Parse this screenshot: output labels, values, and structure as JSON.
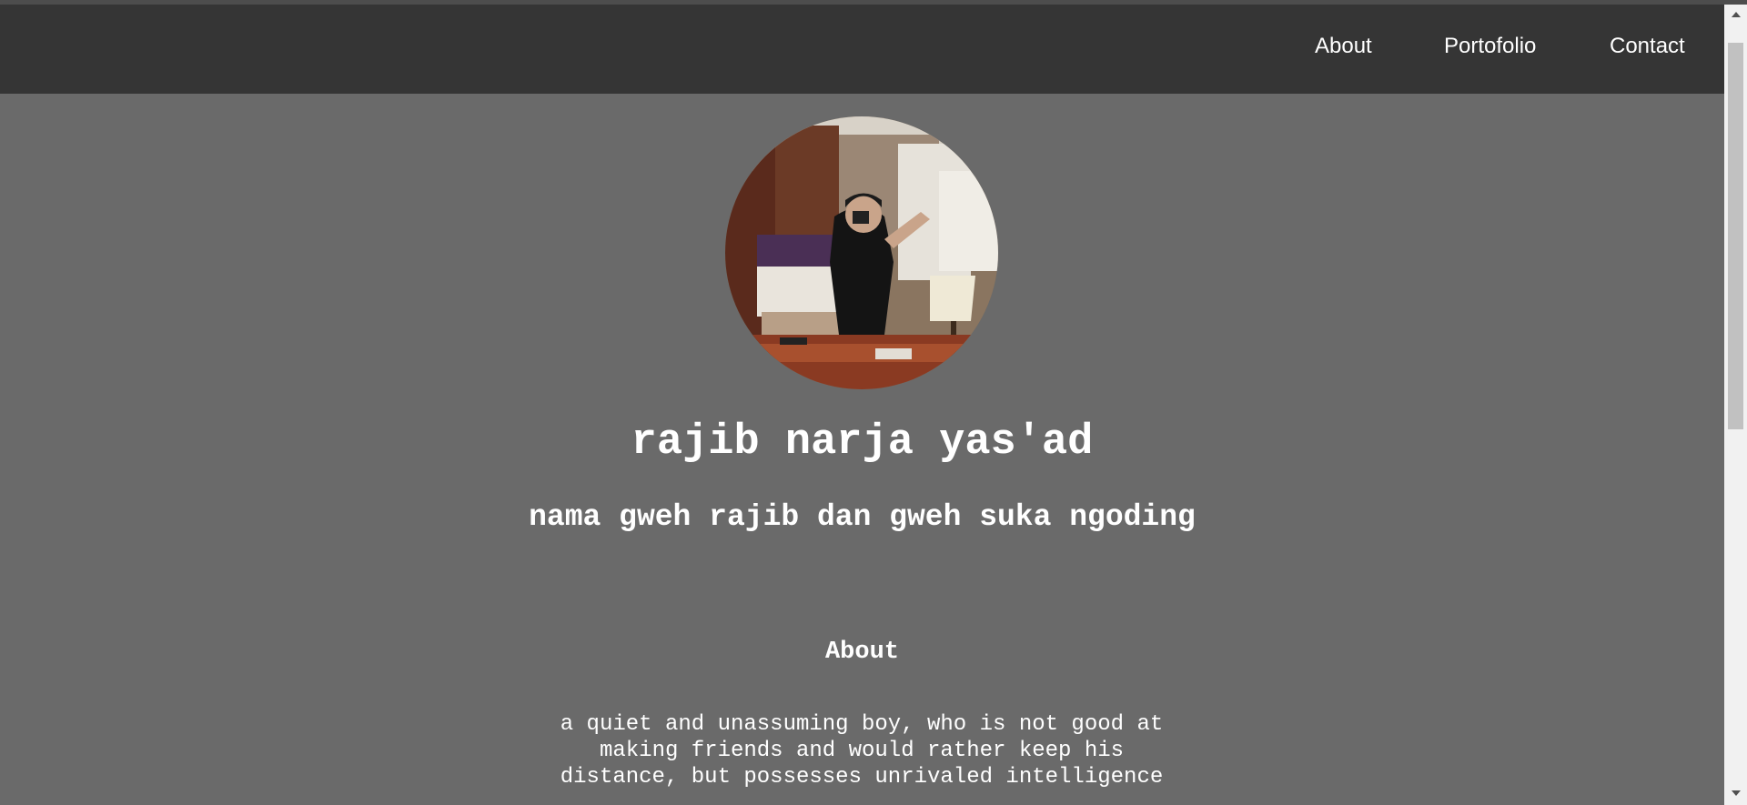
{
  "nav": {
    "about": "About",
    "portofolio": "Portofolio",
    "contact": "Contact"
  },
  "profile": {
    "name": "rajib narja yas'ad",
    "tagline": "nama gweh rajib dan gweh suka ngoding"
  },
  "about": {
    "title": "About",
    "text": "a quiet and unassuming boy, who is not good at making friends and would rather keep his distance, but possesses unrivaled intelligence"
  },
  "icons": {
    "scroll_up": "chevron-up-icon",
    "scroll_down": "chevron-down-icon"
  },
  "colors": {
    "navbar": "#353535",
    "background": "#6a6a6a",
    "text": "#ffffff"
  }
}
